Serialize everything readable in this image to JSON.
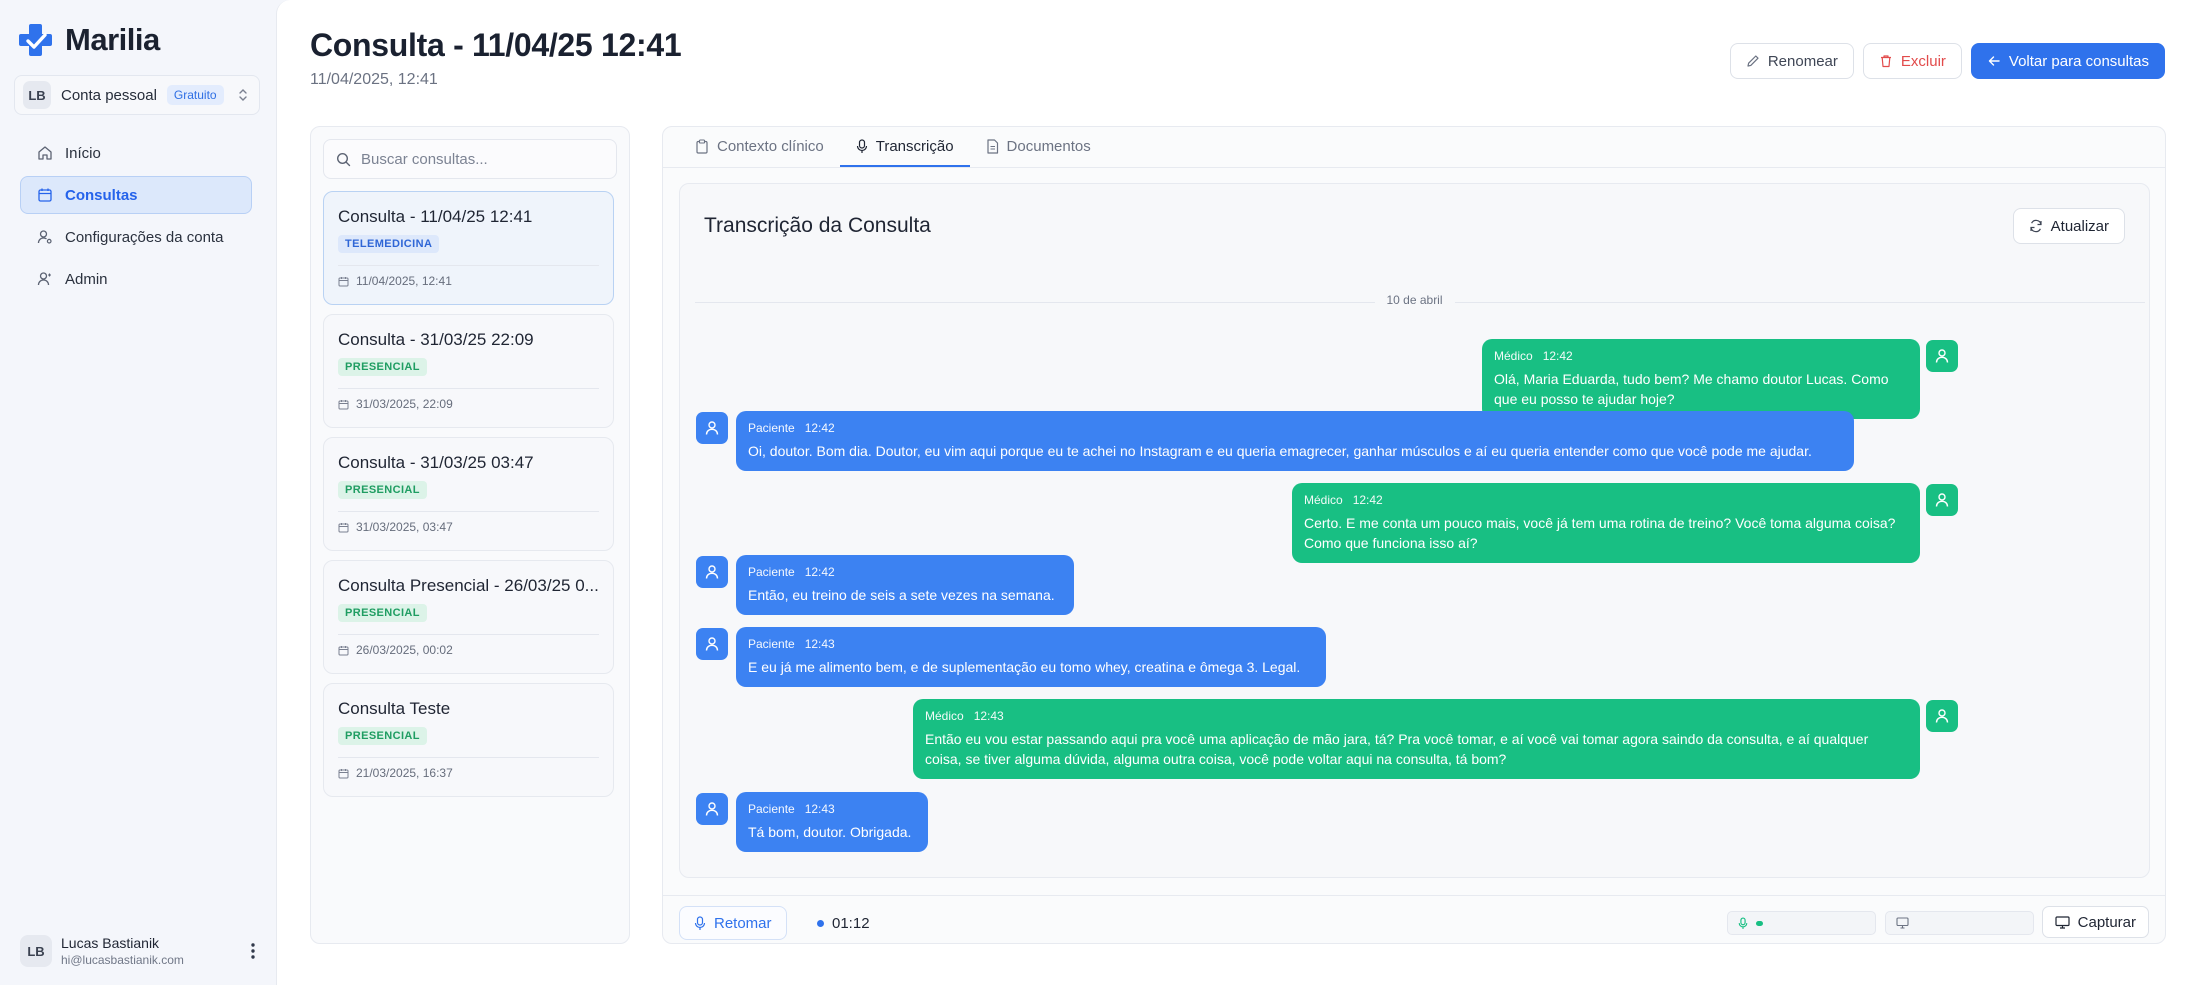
{
  "brand": {
    "name": "Marilia",
    "color": "#2f72ec"
  },
  "account": {
    "initials": "LB",
    "name": "Conta pessoal",
    "plan": "Gratuito"
  },
  "nav": [
    {
      "label": "Início",
      "icon": "home-icon"
    },
    {
      "label": "Consultas",
      "icon": "calendar-icon",
      "active": true
    },
    {
      "label": "Configurações da conta",
      "icon": "user-settings-icon"
    },
    {
      "label": "Admin",
      "icon": "user-icon"
    }
  ],
  "user": {
    "initials": "LB",
    "name": "Lucas Bastianik",
    "email": "hi@lucasbastianik.com"
  },
  "header": {
    "title": "Consulta - 11/04/25 12:41",
    "subtitle": "11/04/2025, 12:41",
    "rename_label": "Renomear",
    "delete_label": "Excluir",
    "back_label": "Voltar para consultas"
  },
  "search": {
    "placeholder": "Buscar consultas..."
  },
  "consultations": [
    {
      "title": "Consulta - 11/04/25 12:41",
      "tag": "TELEMEDICINA",
      "date": "11/04/2025, 12:41"
    },
    {
      "title": "Consulta - 31/03/25 22:09",
      "tag": "PRESENCIAL",
      "date": "31/03/2025, 22:09"
    },
    {
      "title": "Consulta - 31/03/25 03:47",
      "tag": "PRESENCIAL",
      "date": "31/03/2025, 03:47"
    },
    {
      "title": "Consulta Presencial - 26/03/25 0...",
      "tag": "PRESENCIAL",
      "date": "26/03/2025, 00:02"
    },
    {
      "title": "Consulta Teste",
      "tag": "PRESENCIAL",
      "date": "21/03/2025, 16:37"
    }
  ],
  "tabs": [
    {
      "label": "Contexto clínico",
      "icon": "clipboard-icon"
    },
    {
      "label": "Transcrição",
      "icon": "microphone-icon",
      "active": true
    },
    {
      "label": "Documentos",
      "icon": "document-icon"
    }
  ],
  "transcript": {
    "title": "Transcrição da Consulta",
    "refresh_label": "Atualizar",
    "date_divider": "10 de abril",
    "messages": [
      {
        "role": "doctor",
        "speaker": "Médico",
        "time": "12:42",
        "text": "Olá, Maria Eduarda, tudo bem? Me chamo doutor Lucas. Como que eu posso te ajudar hoje?"
      },
      {
        "role": "patient",
        "speaker": "Paciente",
        "time": "12:42",
        "text": "Oi, doutor. Bom dia. Doutor, eu vim aqui porque eu te achei no Instagram e eu queria emagrecer, ganhar músculos e aí eu queria entender como que você pode me ajudar."
      },
      {
        "role": "doctor",
        "speaker": "Médico",
        "time": "12:42",
        "text": "Certo. E me conta um pouco mais, você já tem uma rotina de treino? Você toma alguma coisa? Como que funciona isso aí?"
      },
      {
        "role": "patient",
        "speaker": "Paciente",
        "time": "12:42",
        "text": "Então, eu treino de seis a sete vezes na semana."
      },
      {
        "role": "patient",
        "speaker": "Paciente",
        "time": "12:43",
        "text": "E eu já me alimento bem, e de suplementação eu tomo whey, creatina e ômega 3. Legal."
      },
      {
        "role": "doctor",
        "speaker": "Médico",
        "time": "12:43",
        "text": "Então eu vou estar passando aqui pra você uma aplicação de mão jara, tá? Pra você tomar, e aí você vai tomar agora saindo da consulta, e aí qualquer coisa, se tiver alguma dúvida, alguma outra coisa, você pode voltar aqui na consulta, tá bom?"
      },
      {
        "role": "patient",
        "speaker": "Paciente",
        "time": "12:43",
        "text": "Tá bom, doutor. Obrigada."
      }
    ]
  },
  "bottombar": {
    "resume_label": "Retomar",
    "elapsed": "01:12",
    "mic_level": 0.06,
    "screen_level": 0,
    "capture_label": "Capturar"
  },
  "colors": {
    "doctor": "#18bf83",
    "patient": "#3c82f2",
    "accent": "#2f72ec",
    "danger": "#e24b4b"
  }
}
